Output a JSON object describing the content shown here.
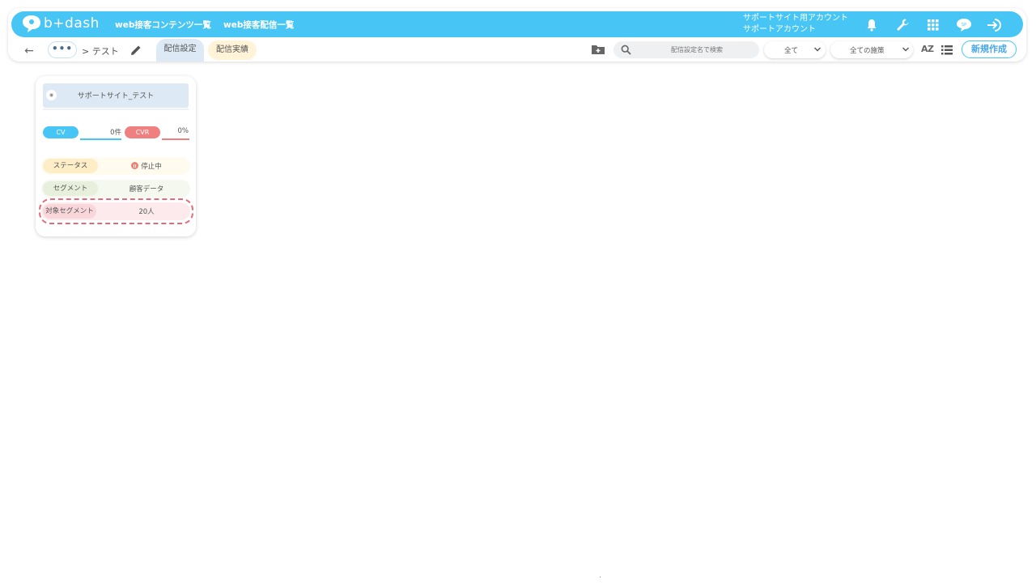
{
  "app": {
    "logo_text": "b+dash"
  },
  "topnav": {
    "links": [
      "web接客コンテンツ一覧",
      "web接客配信一覧"
    ],
    "account_line1": "サポートサイト用アカウント",
    "account_line2": "サポートアカウント",
    "icons": [
      "bell-icon",
      "wrench-icon",
      "apps-grid-icon",
      "support-chat-icon",
      "logout-icon"
    ]
  },
  "subbar": {
    "more_label": "•••",
    "breadcrumb": "> テスト",
    "tabs": [
      "配信設定",
      "配信実績"
    ],
    "search_placeholder": "配信設定名で検索",
    "filter_all": "全て",
    "filter_measures": "全ての施策",
    "sort_label": "AZ",
    "new_button": "新規作成"
  },
  "card": {
    "title": "サポートサイト_テスト",
    "cv_label": "CV",
    "cv_value": "0件",
    "cvr_label": "CVR",
    "cvr_value": "0%",
    "status_label": "ステータス",
    "status_value": "停止中",
    "segment_label": "セグメント",
    "segment_value": "顧客データ",
    "target_label": "対象セグメント",
    "target_value": "20人"
  },
  "colors": {
    "brand": "#47c5f5",
    "cv": "#47c5f5",
    "cvr": "#f08080",
    "highlight": "#e46a78"
  }
}
